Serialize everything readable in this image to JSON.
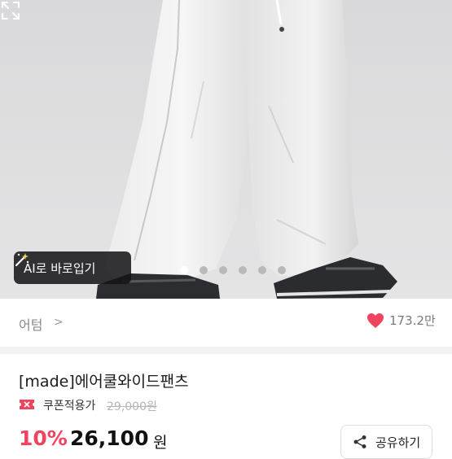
{
  "hero": {
    "ai_button_label": "AI로 바로입기",
    "carousel_total": 6,
    "carousel_active": 1
  },
  "store": {
    "name": "어텀",
    "like_count": "173.2만"
  },
  "product": {
    "title": "[made]에어쿨와이드팬츠",
    "coupon_label": "쿠폰적용가",
    "original_price": "29,000원",
    "discount": "10%",
    "price": "26,100",
    "currency": "원"
  },
  "actions": {
    "share_label": "공유하기"
  },
  "colors": {
    "accent": "#f0445e",
    "heart": "#f0445e"
  },
  "icons": {
    "ai": "magic-wand-icon",
    "expand": "expand-icon",
    "store_chevron": "chevron-right-icon",
    "like": "heart-icon",
    "coupon": "coupon-icon",
    "share": "share-icon"
  }
}
